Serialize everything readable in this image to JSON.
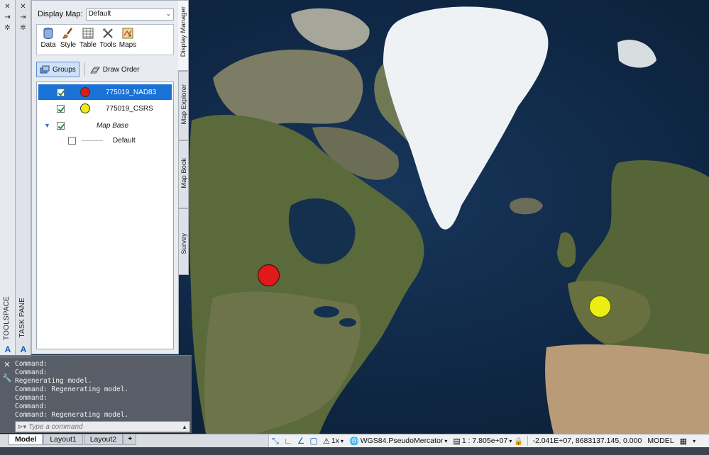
{
  "colors": {
    "layer_nad83": "#e0191a",
    "layer_csrs": "#eded16",
    "selection": "#1a72d6",
    "map_water": "#0f2744"
  },
  "toolspace_strip": {
    "label": "TOOLSPACE",
    "icons": [
      "close-icon",
      "pin-icon",
      "settings-icon"
    ]
  },
  "taskpane_strip": {
    "label": "TASK PANE",
    "icons": [
      "close-icon",
      "pin-icon",
      "settings-icon"
    ]
  },
  "taskpane": {
    "display_map_label": "Display Map:",
    "display_map_value": "Default",
    "toolbar": [
      {
        "label": "Data",
        "icon": "database-icon"
      },
      {
        "label": "Style",
        "icon": "paintbrush-icon"
      },
      {
        "label": "Table",
        "icon": "table-icon"
      },
      {
        "label": "Tools",
        "icon": "tools-icon"
      },
      {
        "label": "Maps",
        "icon": "maps-icon"
      }
    ],
    "groups_label": "Groups",
    "draw_order_label": "Draw Order",
    "layers": [
      {
        "name": "775019_NAD83",
        "checked": true,
        "selected": true,
        "symbol": "red-circle"
      },
      {
        "name": "775019_CSRS",
        "checked": true,
        "selected": false,
        "symbol": "yellow-circle"
      },
      {
        "name": "Map Base",
        "checked": true,
        "selected": false,
        "group": true
      },
      {
        "name": "Default",
        "checked": false,
        "selected": false
      }
    ],
    "side_tabs": [
      "Display Manager",
      "Map Explorer",
      "Map Book",
      "Survey"
    ]
  },
  "command_window": {
    "history": [
      "Command:",
      "Command:",
      "Regenerating model.",
      "Command: Regenerating model.",
      "Command:",
      "Command:",
      "Command: Regenerating model."
    ],
    "input_placeholder": "Type a command"
  },
  "layout_tabs": [
    "Model",
    "Layout1",
    "Layout2",
    "+"
  ],
  "statusbar": {
    "annotation_scale": "1x",
    "coordinate_system": "WGS84.PseudoMercator",
    "scale": "1 : 7.805e+07",
    "coordinates": "-2.041E+07, 8683137.145, 0.000",
    "space": "MODEL"
  }
}
